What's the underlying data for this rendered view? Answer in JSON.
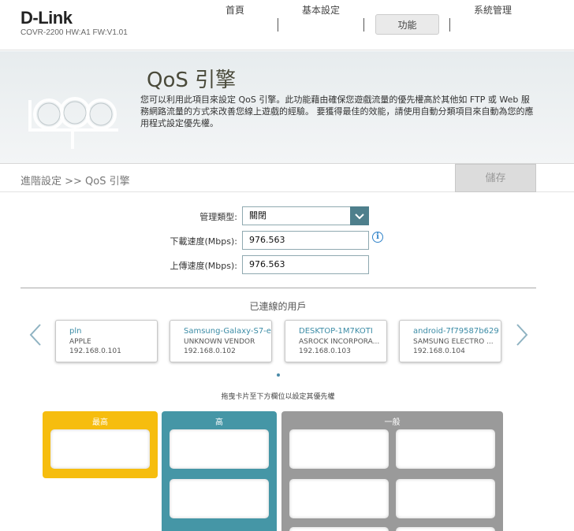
{
  "header": {
    "logo": "D-Link",
    "model": "COVR-2200 HW:A1 FW:V1.01",
    "nav": [
      "首頁",
      "基本設定",
      "功能",
      "系統管理"
    ],
    "active_nav": "功能"
  },
  "banner": {
    "title": "QoS 引擎",
    "description": "您可以利用此項目來設定 QoS 引擎。此功能藉由確保您遊戲流量的優先權高於其他如 FTP 或 Web 服務網路流量的方式來改善您線上遊戲的經驗。 要獲得最佳的效能，請使用自動分類項目來自動為您的應用程式設定優先權。"
  },
  "breadcrumb": "進階設定 >> QoS 引擎",
  "save_label": "儲存",
  "form": {
    "management_type_label": "管理類型:",
    "management_type_value": "關閉",
    "download_label": "下載速度(Mbps):",
    "download_value": "976.563",
    "upload_label": "上傳速度(Mbps):",
    "upload_value": "976.563"
  },
  "connected_title": "已連線的用戶",
  "clients": [
    {
      "name": "pln",
      "vendor": "APPLE",
      "ip": "192.168.0.101"
    },
    {
      "name": "Samsung-Galaxy-S7-e",
      "vendor": "UNKNOWN VENDOR",
      "ip": "192.168.0.102"
    },
    {
      "name": "DESKTOP-1M7KOTI",
      "vendor": "ASROCK INCORPORA...",
      "ip": "192.168.0.103"
    },
    {
      "name": "android-7f79587b629",
      "vendor": "SAMSUNG ELECTRO ...",
      "ip": "192.168.0.104"
    }
  ],
  "drag_hint": "拖曳卡片至下方欄位以設定其優先權",
  "priorities": [
    {
      "label": "最高",
      "color": "#f6bd0e"
    },
    {
      "label": "高",
      "color": "#4596a6"
    },
    {
      "label": "一般",
      "color": "#9a9a9a"
    }
  ],
  "colors": {
    "accent": "#4e7f8c",
    "link": "#3c8ca6"
  }
}
